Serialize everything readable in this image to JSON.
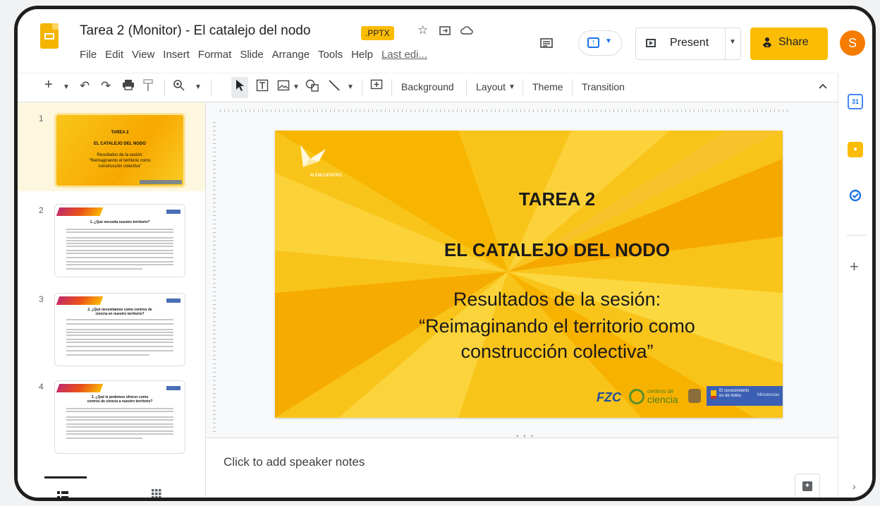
{
  "document": {
    "title": "Tarea 2 (Monitor) - El catalejo del nodo",
    "file_badge": ".PPTX",
    "last_edit": "Last edi..."
  },
  "menu": [
    "File",
    "Edit",
    "View",
    "Insert",
    "Format",
    "Slide",
    "Arrange",
    "Tools",
    "Help"
  ],
  "header": {
    "present_label": "Present",
    "share_label": "Share",
    "avatar_initial": "S"
  },
  "toolbar": {
    "background_label": "Background",
    "layout_label": "Layout",
    "theme_label": "Theme",
    "transition_label": "Transition"
  },
  "slides": [
    {
      "number": "1",
      "title": "TAREA 2",
      "subtitle": "EL CATALEJO DEL NODO",
      "line3": "Resultados de la sesión:",
      "line4": "“Reimaginando el territorio como",
      "line5": "construcción colectiva”"
    },
    {
      "number": "2",
      "title": "1. ¿Qué necesita nuestro territorio?"
    },
    {
      "number": "3",
      "title": "2. ¿Qué necesitamos como centros de",
      "title2": "ciencia en nuestro territorio?"
    },
    {
      "number": "4",
      "title": "3. ¿Qué le podemos ofrecer como",
      "title2": "centros de ciencia a nuestro territorio?"
    }
  ],
  "main_slide": {
    "logo_text": "III ENCUENTRO",
    "heading": "TAREA 2",
    "subheading": "EL CATALEJO DEL NODO",
    "body_line1": "Resultados de la sesión:",
    "body_line2": "“Reimaginando el territorio como",
    "body_line3": "construcción colectiva”",
    "footer_logo1": "FZC",
    "footer_logo2_top": "centros de",
    "footer_logo2_bottom": "ciencia",
    "footer_logo3_line1": "El conocimiento",
    "footer_logo3_line2": "es de todos",
    "footer_logo3_tag": "Minciencias"
  },
  "notes": {
    "placeholder": "Click to add speaker notes"
  },
  "colors": {
    "accent_yellow": "#fbbc04",
    "avatar_orange": "#f57c00",
    "slide_yellow": "#f9c41a",
    "brand_blue": "#1a73e8"
  }
}
